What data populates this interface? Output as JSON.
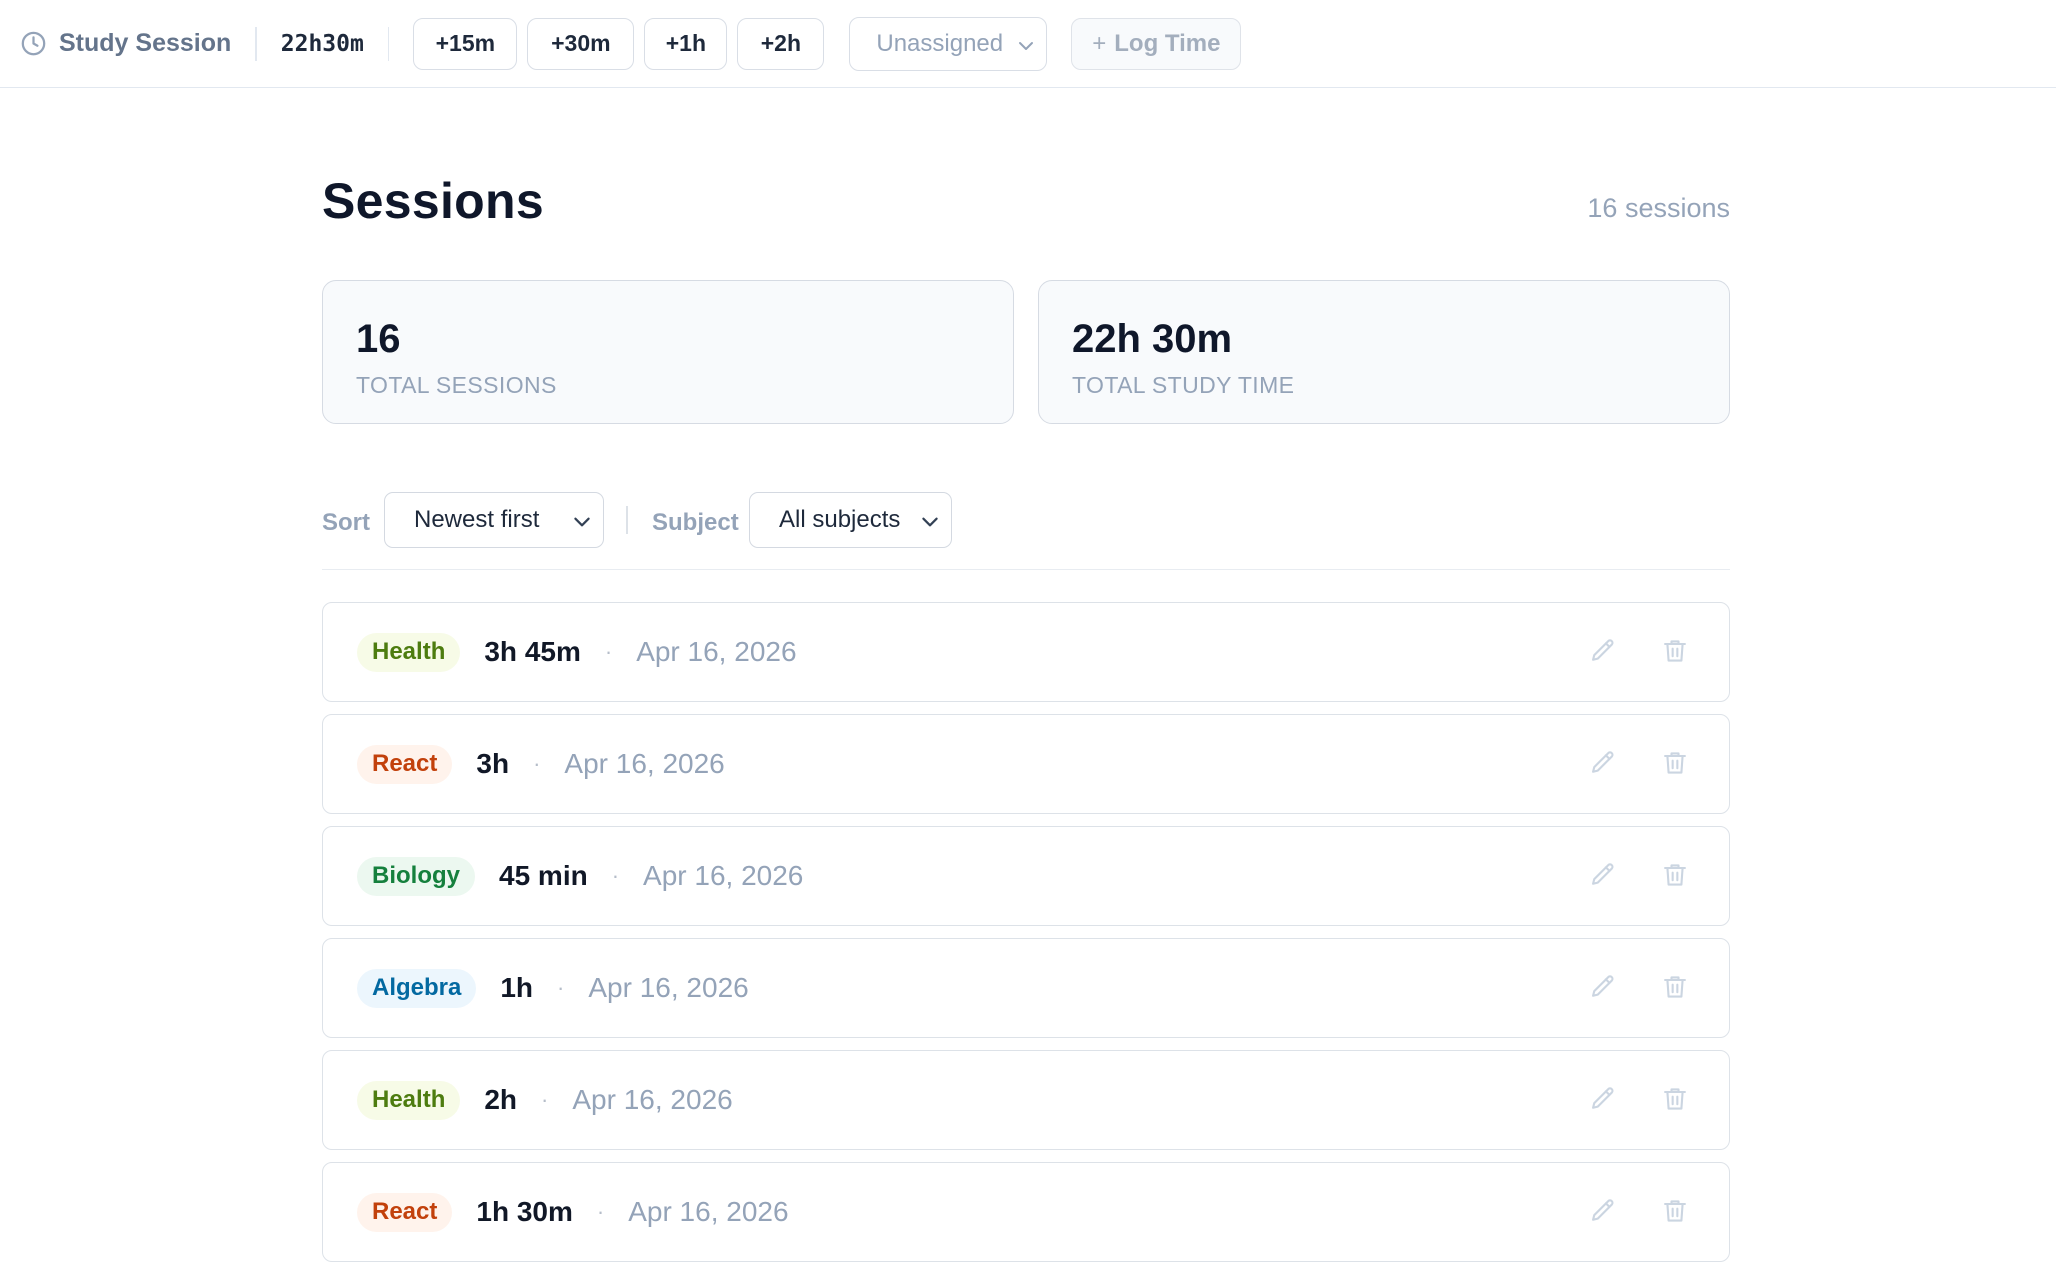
{
  "header": {
    "app_title": "Study Session",
    "total_time": "22h30m",
    "quick_adds": [
      "+15m",
      "+30m",
      "+1h",
      "+2h"
    ],
    "subject_select": {
      "value": "Unassigned"
    },
    "log_time_label": "Log Time"
  },
  "page": {
    "title": "Sessions",
    "session_count_label": "16 sessions"
  },
  "stats": [
    {
      "value": "16",
      "label": "TOTAL SESSIONS"
    },
    {
      "value": "22h 30m",
      "label": "TOTAL STUDY TIME"
    }
  ],
  "filters": {
    "sort_label": "Sort",
    "sort_value": "Newest first",
    "subject_label": "Subject",
    "subject_value": "All subjects"
  },
  "sessions": [
    {
      "subject": "Health",
      "duration": "3h 45m",
      "date": "Apr 16, 2026"
    },
    {
      "subject": "React",
      "duration": "3h",
      "date": "Apr 16, 2026"
    },
    {
      "subject": "Biology",
      "duration": "45 min",
      "date": "Apr 16, 2026"
    },
    {
      "subject": "Algebra",
      "duration": "1h",
      "date": "Apr 16, 2026"
    },
    {
      "subject": "Health",
      "duration": "2h",
      "date": "Apr 16, 2026"
    },
    {
      "subject": "React",
      "duration": "1h 30m",
      "date": "Apr 16, 2026"
    }
  ],
  "separator_glyph": "·",
  "subject_colors": {
    "Health": {
      "bg": "#f7fbe7",
      "fg": "#4d7c0f"
    },
    "React": {
      "bg": "#fff3ec",
      "fg": "#c2410c"
    },
    "Biology": {
      "bg": "#ecf8f0",
      "fg": "#15803d"
    },
    "Algebra": {
      "bg": "#ecf6fd",
      "fg": "#0369a1"
    }
  },
  "icons": {
    "brand": "clock-icon",
    "dropdown": "chevron-down-icon",
    "edit": "pencil-icon",
    "delete": "trash-icon"
  }
}
